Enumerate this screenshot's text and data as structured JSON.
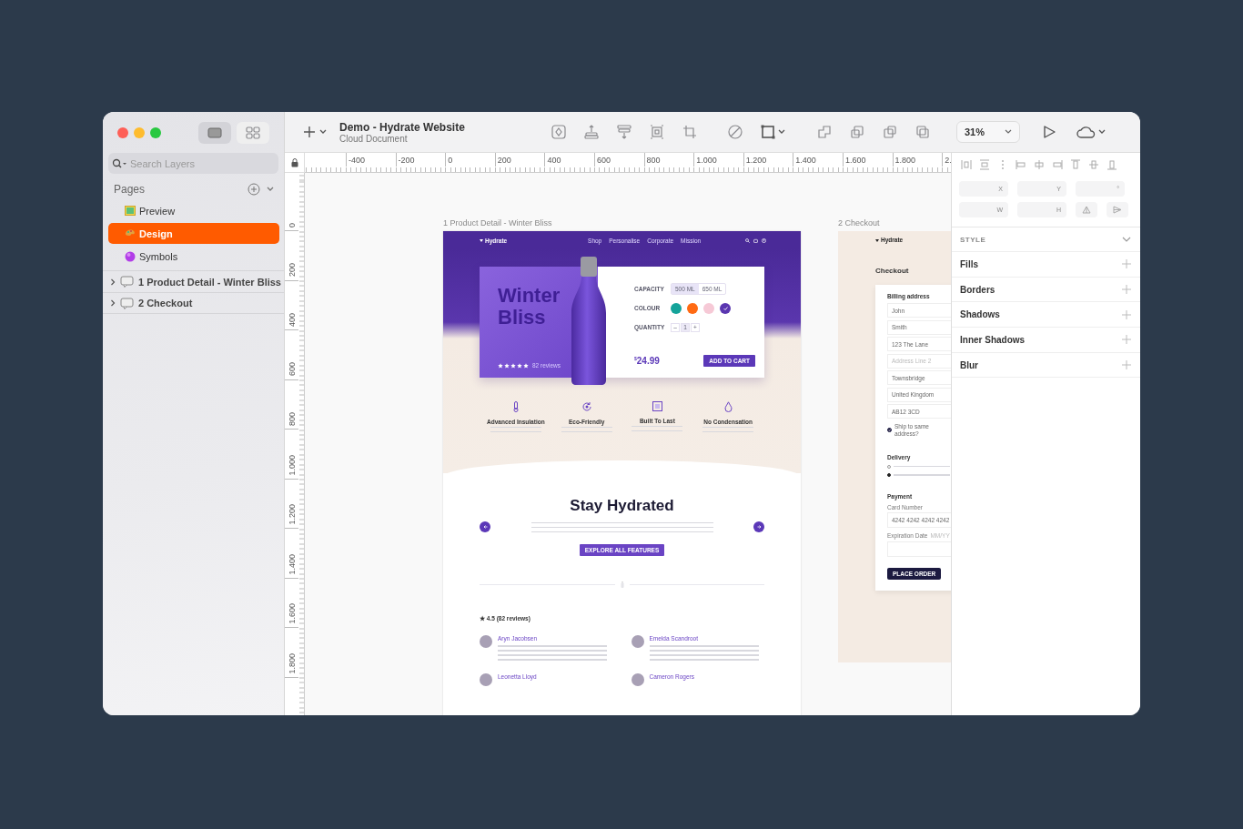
{
  "window": {
    "title": "Demo - Hydrate Website",
    "subtitle": "Cloud Document"
  },
  "sidebar": {
    "search": {
      "placeholder": "Search Layers"
    },
    "pages_label": "Pages",
    "pages": [
      {
        "label": "Preview",
        "kind": "preview",
        "selected": false
      },
      {
        "label": "Design",
        "kind": "design",
        "selected": true
      },
      {
        "label": "Symbols",
        "kind": "symbols",
        "selected": false
      }
    ],
    "layers": [
      {
        "label": "1 Product Detail - Winter Bliss",
        "expanded": false
      },
      {
        "label": "2 Checkout",
        "expanded": false
      }
    ]
  },
  "toolbar": {
    "zoom": "31%"
  },
  "rulers": {
    "horizontal": [
      "-400",
      "-200",
      "0",
      "200",
      "400",
      "600",
      "800",
      "1.000",
      "1.200",
      "1.400",
      "1.600",
      "1.800",
      "2."
    ],
    "vertical": [
      "0",
      "200",
      "400",
      "600",
      "800",
      "1.000",
      "1.200",
      "1.400",
      "1.600",
      "1.800"
    ]
  },
  "artboards": [
    {
      "label": "1 Product Detail - Winter Bliss",
      "kind": "product",
      "brand": "Hydrate",
      "nav": [
        "Shop",
        "Personalise",
        "Corporate",
        "Mission"
      ],
      "hero_title": "Winter Bliss",
      "stars": 5,
      "reviews_count": "82 reviews",
      "capacity_label": "CAPACITY",
      "capacity": [
        {
          "label": "500 ML",
          "selected": true
        },
        {
          "label": "650 ML",
          "selected": false
        }
      ],
      "colour_label": "COLOUR",
      "colours": [
        {
          "color": "#14a39a",
          "selected": false
        },
        {
          "color": "#ff6a13",
          "selected": false
        },
        {
          "color": "#f6c9d6",
          "selected": false
        },
        {
          "color": "#5a36b0",
          "selected": true
        }
      ],
      "quantity_label": "QUANTITY",
      "quantity": {
        "minus": "–",
        "value": "1",
        "plus": "+"
      },
      "currency": "$",
      "price": "24.99",
      "cart_button": "ADD TO CART",
      "features": [
        {
          "kind": "thermometer",
          "title": "Advanced Insulation"
        },
        {
          "kind": "recycle",
          "title": "Eco-Friendly"
        },
        {
          "kind": "square",
          "title": "Built To Last"
        },
        {
          "kind": "drop",
          "title": "No Condensation"
        }
      ],
      "section_title": "Stay Hydrated",
      "section_button": "EXPLORE ALL FEATURES",
      "rating": "★ 4.5 (82 reviews)",
      "reviews": [
        {
          "name": "Aryn Jacobsen",
          "has_text": true
        },
        {
          "name": "Emelda Scandroot",
          "has_text": true
        },
        {
          "name": "Leonetta Lloyd",
          "has_text": false
        },
        {
          "name": "Cameron Rogers",
          "has_text": false
        }
      ]
    },
    {
      "label": "2 Checkout",
      "kind": "checkout",
      "brand": "Hydrate",
      "title": "Checkout",
      "billing_title": "Billing address",
      "fields": [
        {
          "value": "John"
        },
        {
          "value": "Smith"
        },
        {
          "value": "123 The Lane"
        },
        {
          "placeholder": "Address Line 2"
        },
        {
          "value": "Townsbridge"
        },
        {
          "value": "United Kingdom"
        },
        {
          "value": "AB12 3CD"
        }
      ],
      "ship_same": {
        "label": "Ship to same address?",
        "checked": true
      },
      "delivery_title": "Delivery",
      "delivery": [
        {
          "selected": false
        },
        {
          "selected": true
        }
      ],
      "payment_title": "Payment",
      "card_label": "Card Number",
      "card_value": "4242 4242 4242 4242",
      "expiry_label": "Expiration Date",
      "expiry_hint": "MM/YY",
      "button": "PLACE ORDER"
    }
  ],
  "inspector": {
    "fields": [
      {
        "label": "X"
      },
      {
        "label": "Y"
      },
      {
        "label": "°"
      },
      {
        "label": "W"
      },
      {
        "label": "H"
      }
    ],
    "style_label": "STYLE",
    "sections": [
      "Fills",
      "Borders",
      "Shadows",
      "Inner Shadows",
      "Blur"
    ]
  }
}
